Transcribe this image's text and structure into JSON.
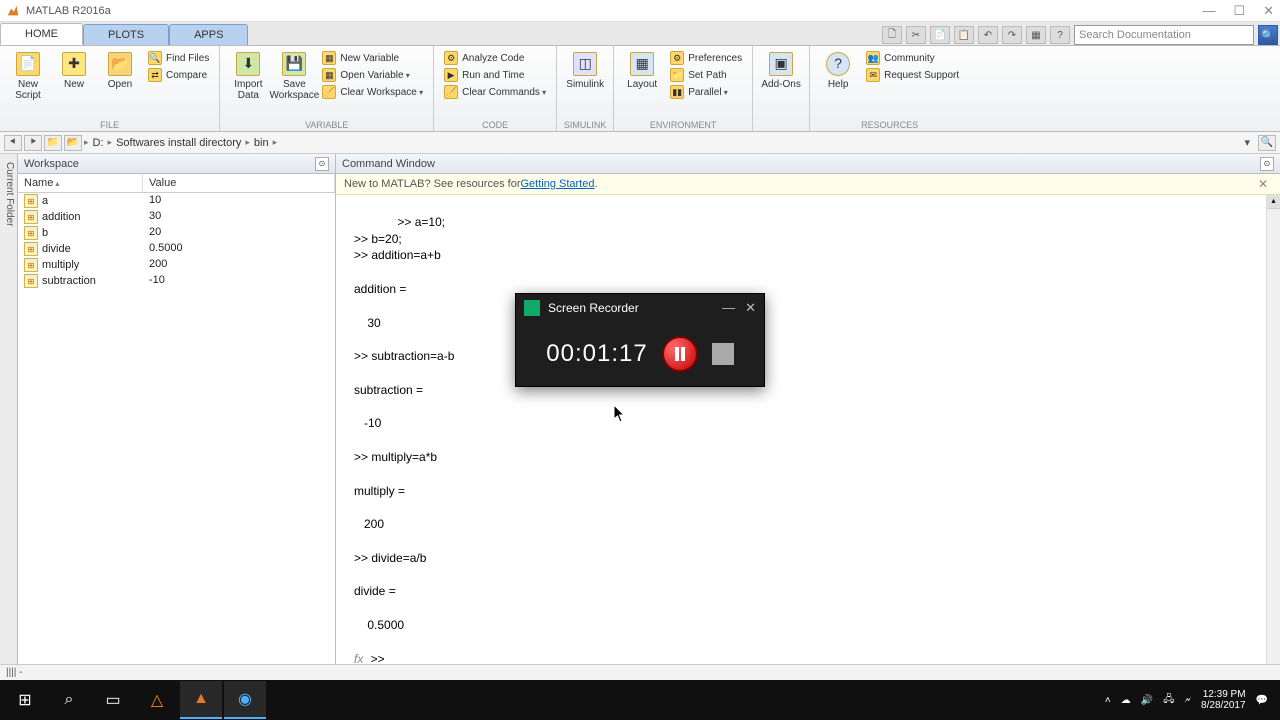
{
  "app_title": "MATLAB R2016a",
  "tabs": {
    "home": "HOME",
    "plots": "PLOTS",
    "apps": "APPS"
  },
  "search_placeholder": "Search Documentation",
  "ribbon": {
    "file": {
      "new_script": "New\nScript",
      "new": "New",
      "open": "Open",
      "find_files": "Find Files",
      "compare": "Compare",
      "import": "Import\nData",
      "save_ws": "Save\nWorkspace",
      "label": "FILE"
    },
    "variable": {
      "new_var": "New Variable",
      "open_var": "Open Variable",
      "clear_ws": "Clear Workspace",
      "label": "VARIABLE"
    },
    "code": {
      "analyze": "Analyze Code",
      "run_time": "Run and Time",
      "clear_cmd": "Clear Commands",
      "label": "CODE"
    },
    "simulink": {
      "btn": "Simulink",
      "label": "SIMULINK"
    },
    "environment": {
      "layout": "Layout",
      "prefs": "Preferences",
      "setpath": "Set Path",
      "parallel": "Parallel",
      "label": "ENVIRONMENT"
    },
    "addons": {
      "btn": "Add-Ons"
    },
    "resources": {
      "help": "Help",
      "community": "Community",
      "support": "Request Support",
      "label": "RESOURCES"
    }
  },
  "address": {
    "drive": "D:",
    "p1": "Softwares install directory",
    "p2": "bin"
  },
  "workspace": {
    "title": "Workspace",
    "cols": {
      "name": "Name",
      "value": "Value"
    },
    "vars": [
      {
        "name": "a",
        "value": "10"
      },
      {
        "name": "addition",
        "value": "30"
      },
      {
        "name": "b",
        "value": "20"
      },
      {
        "name": "divide",
        "value": "0.5000"
      },
      {
        "name": "multiply",
        "value": "200"
      },
      {
        "name": "subtraction",
        "value": "-10"
      }
    ]
  },
  "cmd": {
    "title": "Command Window",
    "banner_pre": "New to MATLAB? See resources for ",
    "banner_link": "Getting Started",
    "content": ">> a=10;\n>> b=20;\n>> addition=a+b\n\naddition =\n\n    30\n\n>> subtraction=a-b\n\nsubtraction =\n\n   -10\n\n>> multiply=a*b\n\nmultiply =\n\n   200\n\n>> divide=a/b\n\ndivide =\n\n    0.5000\n",
    "fx_prompt": ">>"
  },
  "status": "|||| -",
  "recorder": {
    "title": "Screen Recorder",
    "time": "00:01:17"
  },
  "tray": {
    "time": "12:39 PM",
    "date": "8/28/2017"
  }
}
